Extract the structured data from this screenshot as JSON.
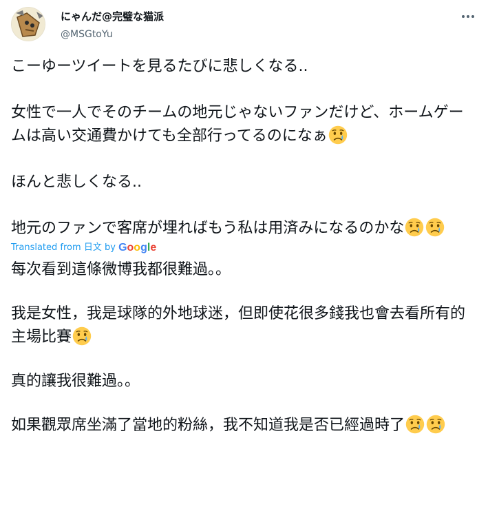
{
  "tweet": {
    "author": {
      "display_name": "にゃんだ@完璧な猫派",
      "handle": "@MSGtoYu",
      "avatar_icon": "cat-avatar"
    },
    "more_icon": "more-horizontal-icon",
    "original_paragraphs": [
      "こーゆーツイートを見るたびに悲しくなる..",
      "女性で一人でそのチームの地元じゃないファンだけど、ホームゲームは高い交通費かけても全部行ってるのになぁ",
      "ほんと悲しくなる..",
      "地元のファンで客席が埋ればもう私は用済みになるのかな"
    ],
    "translation": {
      "label_prefix": "Translated from",
      "language": "日文",
      "label_by": "by",
      "provider": "Google",
      "paragraphs": [
        "每次看到這條微博我都很難過。。",
        "我是女性，我是球隊的外地球迷，但即使花很多錢我也會去看所有的主場比賽",
        "真的讓我很難過。。",
        "如果觀眾席坐滿了當地的粉絲，我不知道我是否已經過時了"
      ]
    },
    "emoji_name": "crying-face-emoji"
  }
}
